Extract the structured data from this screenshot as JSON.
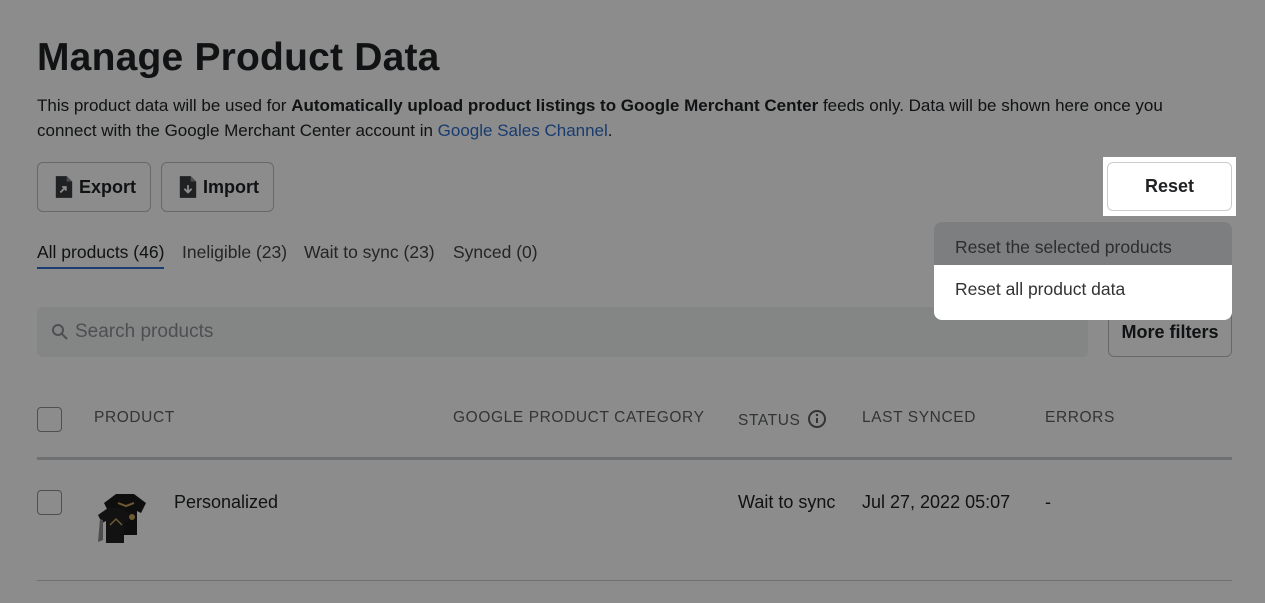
{
  "page": {
    "title": "Manage Product Data",
    "desc_prefix": "This product data will be used for ",
    "desc_bold": "Automatically upload product listings to Google Merchant Center",
    "desc_middle": " feeds only. Data will be shown here once you connect with the Google Merchant Center account in ",
    "desc_link": "Google Sales Channel",
    "desc_suffix": "."
  },
  "toolbar": {
    "export_label": "Export",
    "import_label": "Import",
    "reset_label": "Reset"
  },
  "reset_menu": {
    "items": [
      {
        "label": "Reset the selected products"
      },
      {
        "label": "Reset all product data"
      }
    ]
  },
  "tabs": [
    {
      "label": "All products (46)"
    },
    {
      "label": "Ineligible (23)"
    },
    {
      "label": "Wait to sync (23)"
    },
    {
      "label": "Synced (0)"
    }
  ],
  "search": {
    "placeholder": "Search products"
  },
  "filters": {
    "more_label": "More filters"
  },
  "table": {
    "headers": [
      "PRODUCT",
      "GOOGLE PRODUCT CATEGORY",
      "STATUS",
      "LAST SYNCED",
      "ERRORS"
    ],
    "rows": [
      {
        "product": "Personalized",
        "category": "",
        "status": "Wait to sync",
        "last_synced": "Jul 27, 2022 05:07",
        "errors": "-"
      }
    ]
  },
  "colors": {
    "link": "#2c6ecb",
    "overlay": "rgba(0,0,0,0.45)"
  }
}
